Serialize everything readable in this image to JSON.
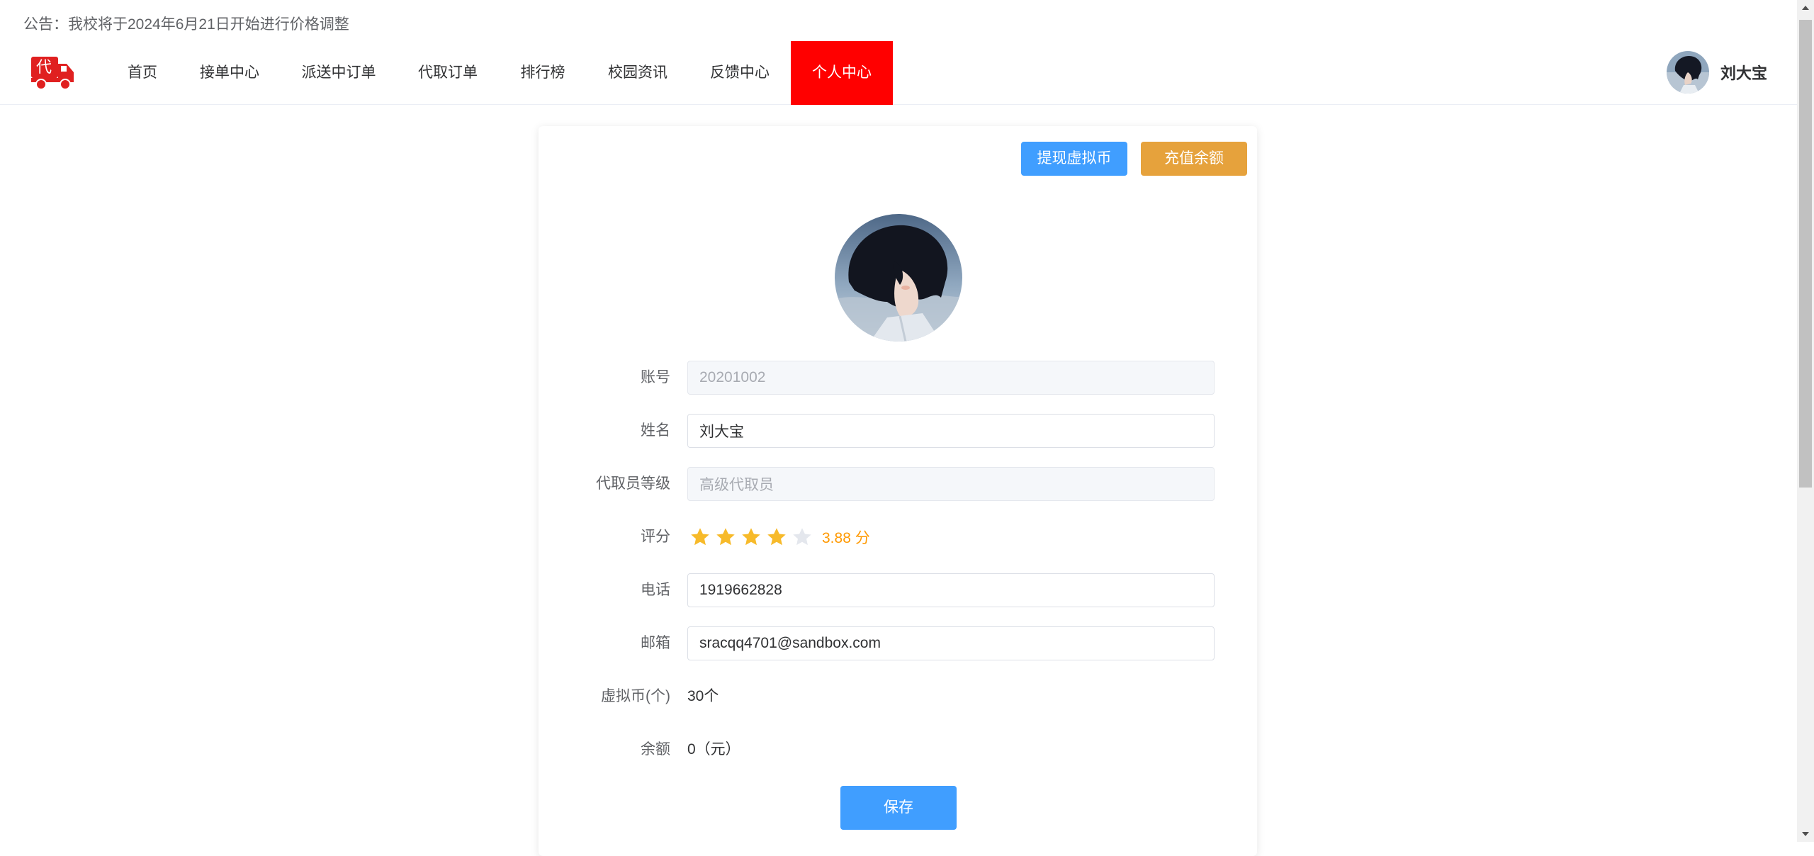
{
  "notice": {
    "prefix": "公告：",
    "text": "我校将于2024年6月21日开始进行价格调整"
  },
  "logo": {
    "char": "代"
  },
  "nav": {
    "items": [
      {
        "label": "首页"
      },
      {
        "label": "接单中心"
      },
      {
        "label": "派送中订单"
      },
      {
        "label": "代取订单"
      },
      {
        "label": "排行榜"
      },
      {
        "label": "校园资讯"
      },
      {
        "label": "反馈中心"
      },
      {
        "label": "个人中心",
        "active": true
      }
    ]
  },
  "user": {
    "name": "刘大宝"
  },
  "actions": {
    "withdraw_label": "提现虚拟币",
    "recharge_label": "充值余额"
  },
  "form": {
    "account": {
      "label": "账号",
      "value": "20201002"
    },
    "name": {
      "label": "姓名",
      "value": "刘大宝"
    },
    "level": {
      "label": "代取员等级",
      "value": "高级代取员"
    },
    "rating": {
      "label": "评分",
      "score": 3.88,
      "max": 5,
      "text": "3.88 分"
    },
    "phone": {
      "label": "电话",
      "value": "1919662828"
    },
    "email": {
      "label": "邮箱",
      "value": "sracqq4701@sandbox.com"
    },
    "coins": {
      "label": "虚拟币(个)",
      "value": "30个"
    },
    "balance": {
      "label": "余额",
      "value": "0（元）"
    }
  },
  "save_label": "保存",
  "colors": {
    "active_nav": "#ff0000",
    "primary": "#409eff",
    "warning": "#e6a23c",
    "star": "#f7ba2a"
  }
}
